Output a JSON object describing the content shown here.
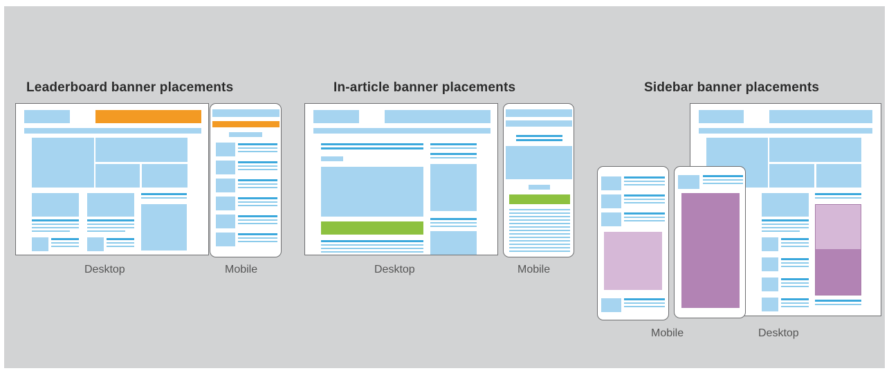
{
  "sections": {
    "leaderboard": {
      "title": "Leaderboard banner placements",
      "desktop_label": "Desktop",
      "mobile_label": "Mobile"
    },
    "in_article": {
      "title": "In-article banner placements",
      "desktop_label": "Desktop",
      "mobile_label": "Mobile"
    },
    "sidebar": {
      "title": "Sidebar banner placements",
      "mobile_label": "Mobile",
      "desktop_label": "Desktop"
    }
  },
  "colors": {
    "background": "#d2d3d4",
    "content_block": "#a6d4f0",
    "text_line": "#3ba8dc",
    "leaderboard_banner": "#f39a23",
    "in_article_banner": "#8dc13f",
    "sidebar_banner_light": "#d6b8d7",
    "sidebar_banner_dark": "#b283b4"
  }
}
